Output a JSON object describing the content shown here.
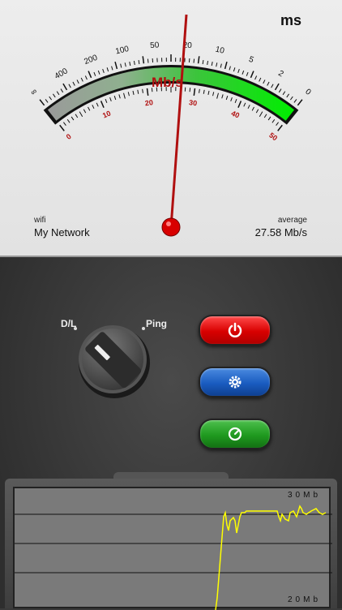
{
  "meter": {
    "unit_ms": "ms",
    "unit_mbs": "Mb/s",
    "ms_scale": [
      "∞",
      "400",
      "200",
      "100",
      "50",
      "20",
      "10",
      "5",
      "2",
      "0"
    ],
    "mbs_scale": [
      "0",
      "10",
      "20",
      "30",
      "40",
      "50"
    ],
    "needle_value_mbs": 27.58,
    "wifi_label": "wifi",
    "network_name": "My Network",
    "average_label": "average",
    "average_value": "27.58 Mb/s"
  },
  "controls": {
    "knob_left_label": "D/L",
    "knob_right_label": "Ping",
    "power_icon": "power-icon",
    "settings_icon": "gear-icon",
    "test_icon": "ping-icon"
  },
  "graph": {
    "top_label": "30Mb",
    "bottom_label": "20Mb",
    "line_color": "#ffff00"
  },
  "colors": {
    "power": "#e00000",
    "settings": "#1a5cc0",
    "test": "#1f9a1f",
    "needle": "#b01010"
  }
}
